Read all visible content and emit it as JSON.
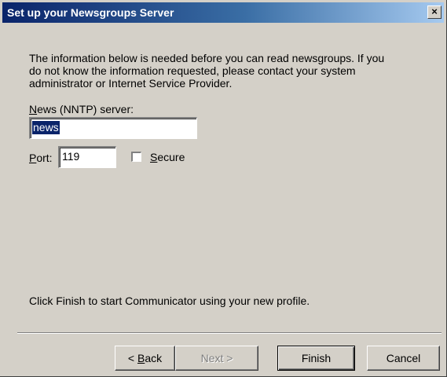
{
  "dialog": {
    "title": "Set up your Newsgroups Server",
    "close_label": "×",
    "intro": "The information below is needed before you can read newsgroups.  If you do not know the information requested, please contact your system administrator or Internet Service Provider.",
    "server_label_accesskey": "N",
    "server_label_rest": "ews (NNTP) server:",
    "server_value": "news",
    "port_label_accesskey": "P",
    "port_label_rest": "ort:",
    "port_value": "119",
    "secure_checked": false,
    "secure_label_accesskey": "S",
    "secure_label_rest": "ecure",
    "finish_hint": "Click Finish to start Communicator using your new profile."
  },
  "buttons": {
    "back": "< Back",
    "back_accesskey": "B",
    "next": "Next >",
    "finish": "Finish",
    "cancel": "Cancel"
  },
  "colors": {
    "face": "#d4d0c8",
    "title_start": "#0a246a",
    "title_end": "#a6caf0",
    "selection": "#0a246a"
  }
}
